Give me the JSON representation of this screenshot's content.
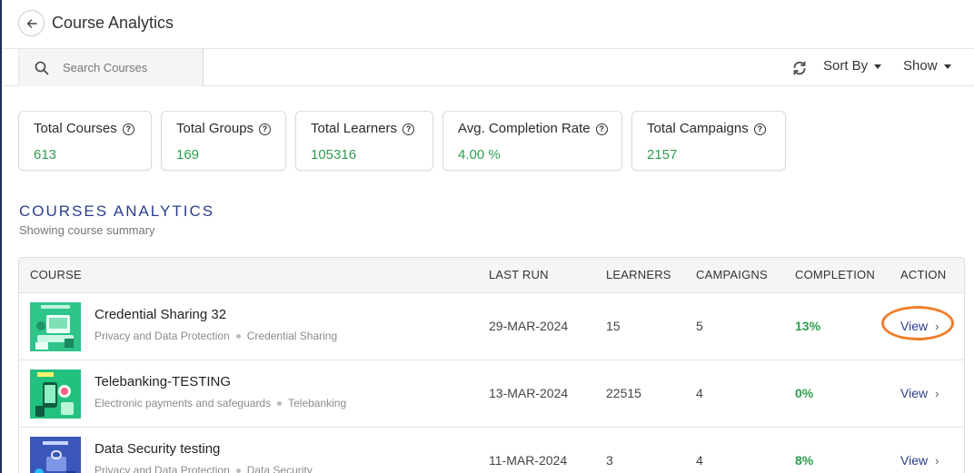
{
  "header": {
    "title": "Course Analytics"
  },
  "toolbar": {
    "search_placeholder": "Search Courses",
    "sort_label": "Sort By",
    "show_label": "Show"
  },
  "stats": [
    {
      "label": "Total Courses",
      "value": "613"
    },
    {
      "label": "Total Groups",
      "value": "169"
    },
    {
      "label": "Total Learners",
      "value": "105316"
    },
    {
      "label": "Avg. Completion Rate",
      "value": "4.00 %"
    },
    {
      "label": "Total Campaigns",
      "value": "2157"
    }
  ],
  "section": {
    "title": "COURSES ANALYTICS",
    "subtitle": "Showing course summary"
  },
  "table": {
    "headers": {
      "course": "COURSE",
      "last_run": "LAST RUN",
      "learners": "LEARNERS",
      "campaigns": "CAMPAIGNS",
      "completion": "COMPLETION",
      "action": "ACTION"
    },
    "rows": [
      {
        "name": "Credential Sharing 32",
        "category": "Privacy and Data Protection",
        "topic": "Credential Sharing",
        "last_run": "29-MAR-2024",
        "learners": "15",
        "campaigns": "5",
        "completion": "13%",
        "action": "View",
        "thumb_color": "#2ec48a"
      },
      {
        "name": "Telebanking-TESTING",
        "category": "Electronic payments and safeguards",
        "topic": "Telebanking",
        "last_run": "13-MAR-2024",
        "learners": "22515",
        "campaigns": "4",
        "completion": "0%",
        "action": "View",
        "thumb_color": "#22c17f"
      },
      {
        "name": "Data Security testing",
        "category": "Privacy and Data Protection",
        "topic": "Data Security",
        "last_run": "11-MAR-2024",
        "learners": "3",
        "campaigns": "4",
        "completion": "8%",
        "action": "View",
        "thumb_color": "#3a56b8"
      }
    ]
  },
  "colors": {
    "accent": "#2c3e8c",
    "positive": "#2e9e4f",
    "highlight": "#f07d2a"
  }
}
